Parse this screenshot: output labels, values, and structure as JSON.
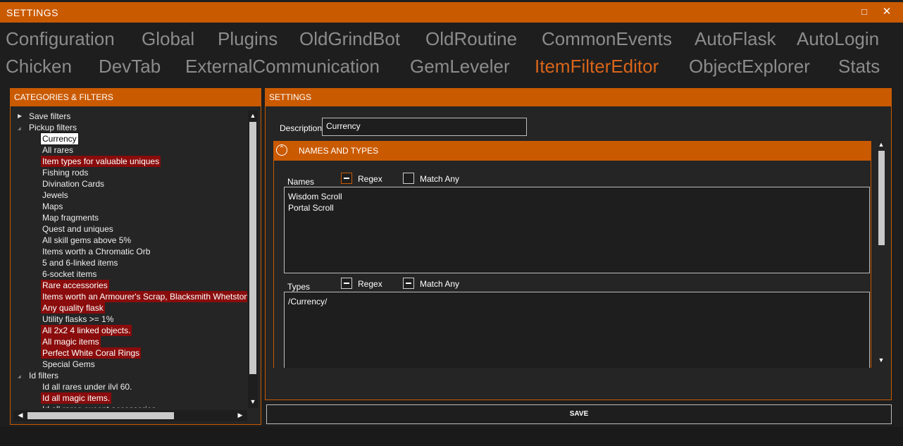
{
  "window": {
    "title": "SETTINGS",
    "maximize_glyph": "□",
    "close_glyph": "✕"
  },
  "tabs_row1": [
    "Configuration",
    "Global",
    "Plugins",
    "OldGrindBot",
    "OldRoutine",
    "CommonEvents",
    "AutoFlask",
    "AutoLogin"
  ],
  "tabs_row2": [
    "Chicken",
    "DevTab",
    "ExternalCommunication",
    "GemLeveler",
    "ItemFilterEditor",
    "ObjectExplorer",
    "Stats"
  ],
  "active_tab": "ItemFilterEditor",
  "left_panel": {
    "title": "CATEGORIES & FILTERS",
    "tree": [
      {
        "label": "Save filters",
        "level": 0,
        "expander": "collapsed"
      },
      {
        "label": "Pickup filters",
        "level": 0,
        "expander": "expanded"
      },
      {
        "label": "Currency",
        "level": 1,
        "state": "selected"
      },
      {
        "label": "All rares",
        "level": 1
      },
      {
        "label": "Item types for valuable uniques",
        "level": 1,
        "state": "highlighted"
      },
      {
        "label": "Fishing rods",
        "level": 1
      },
      {
        "label": "Divination Cards",
        "level": 1
      },
      {
        "label": "Jewels",
        "level": 1
      },
      {
        "label": "Maps",
        "level": 1
      },
      {
        "label": "Map fragments",
        "level": 1
      },
      {
        "label": "Quest and uniques",
        "level": 1
      },
      {
        "label": "All skill gems above 5%",
        "level": 1
      },
      {
        "label": "Items worth a Chromatic Orb",
        "level": 1
      },
      {
        "label": "5 and 6-linked items",
        "level": 1
      },
      {
        "label": "6-socket items",
        "level": 1
      },
      {
        "label": "Rare accessories",
        "level": 1,
        "state": "highlighted"
      },
      {
        "label": "Items worth an Armourer's Scrap, Blacksmith Whetstone",
        "level": 1,
        "state": "highlighted"
      },
      {
        "label": "Any quality flask",
        "level": 1,
        "state": "highlighted"
      },
      {
        "label": "Utility flasks >= 1%",
        "level": 1
      },
      {
        "label": "All 2x2 4 linked objects.",
        "level": 1,
        "state": "highlighted"
      },
      {
        "label": "All magic items",
        "level": 1,
        "state": "highlighted"
      },
      {
        "label": "Perfect White Coral Rings",
        "level": 1,
        "state": "highlighted"
      },
      {
        "label": "Special Gems",
        "level": 1
      },
      {
        "label": "Id filters",
        "level": 0,
        "expander": "expanded"
      },
      {
        "label": "Id all rares under ilvl 60.",
        "level": 1
      },
      {
        "label": "Id all magic items.",
        "level": 1,
        "state": "highlighted"
      },
      {
        "label": "Id all rares except accessories",
        "level": 1
      }
    ],
    "scroll_glyphs": {
      "up": "▲",
      "down": "▼",
      "left": "◀",
      "right": "▶"
    }
  },
  "right_panel": {
    "title": "SETTINGS",
    "description_label": "Description",
    "description_value": "Currency",
    "section_title": "NAMES AND TYPES",
    "section_glyph": "⌃",
    "names": {
      "label": "Names",
      "regex_label": "Regex",
      "match_any_label": "Match Any",
      "regex_state": "indeterminate",
      "match_any_state": "unchecked",
      "lines": [
        "Wisdom Scroll",
        "Portal Scroll"
      ]
    },
    "types": {
      "label": "Types",
      "regex_label": "Regex",
      "match_any_label": "Match Any",
      "regex_state": "indeterminate",
      "match_any_state": "indeterminate",
      "lines": [
        "/Currency/"
      ]
    },
    "scroll_glyphs": {
      "up": "▲",
      "down": "▼"
    },
    "save_label": "SAVE"
  },
  "colors": {
    "accent": "#ca5a00",
    "active_tab": "#d9651a",
    "highlight": "#8a0c0c",
    "background": "#1e1e1e"
  }
}
